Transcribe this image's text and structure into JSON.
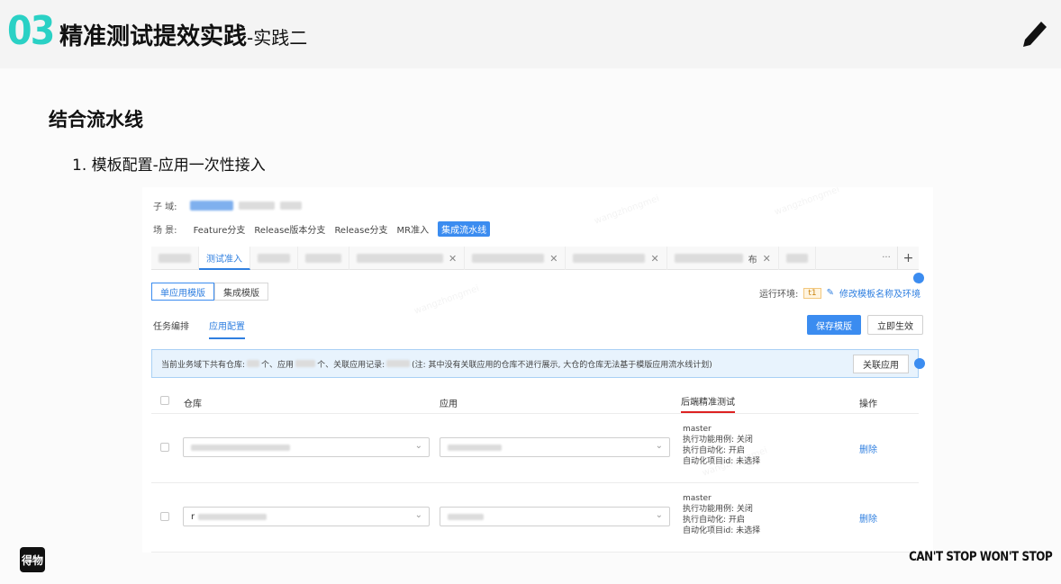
{
  "slide": {
    "section_number": "03",
    "title": "精准测试提效实践",
    "subtitle": "-实践二",
    "heading": "结合流水线",
    "step": "1. 模板配置-应用一次性接入",
    "logo_text": "得物",
    "tagline": "CAN'T STOP WON'T STOP"
  },
  "app": {
    "domain_label": "子  域:",
    "scene_label": "场  景:",
    "scenes": [
      "Feature分支",
      "Release版本分支",
      "Release分支",
      "MR准入",
      "集成流水线"
    ],
    "tabs": [
      "测试准入"
    ],
    "tab_suffix_text": "布",
    "tabs_more": "···",
    "tabs_add": "+",
    "mode_buttons": [
      "单应用模版",
      "集成模版"
    ],
    "env_label": "运行环境:",
    "env_value": "t1",
    "env_link": "修改模板名称及环境",
    "subtabs": [
      "任务编排",
      "应用配置"
    ],
    "save_button": "保存模版",
    "apply_button": "立即生效",
    "notice": {
      "prefix": "当前业务域下共有仓库:",
      "part2": "个、应用",
      "part3": "个、关联应用记录:",
      "note": "(注: 其中没有关联应用的仓库不进行展示, 大仓的仓库无法基于模版应用流水线计划)",
      "button": "关联应用"
    },
    "table": {
      "columns": [
        "仓库",
        "应用",
        "后端精准测试",
        "操作"
      ],
      "rows": [
        {
          "repo_prefix": "",
          "app_prefix": "",
          "config": [
            "master",
            "执行功能用例: 关闭",
            "执行自动化: 开启",
            "自动化项目id: 未选择"
          ],
          "action": "删除"
        },
        {
          "repo_prefix": "r",
          "app_prefix": "",
          "config": [
            "master",
            "执行功能用例: 关闭",
            "执行自动化: 开启",
            "自动化项目id: 未选择"
          ],
          "action": "删除"
        }
      ]
    }
  },
  "colors": {
    "accent_teal": "#2ad1c5",
    "primary_blue": "#3b8cf0",
    "highlight_red": "#dd2222"
  }
}
